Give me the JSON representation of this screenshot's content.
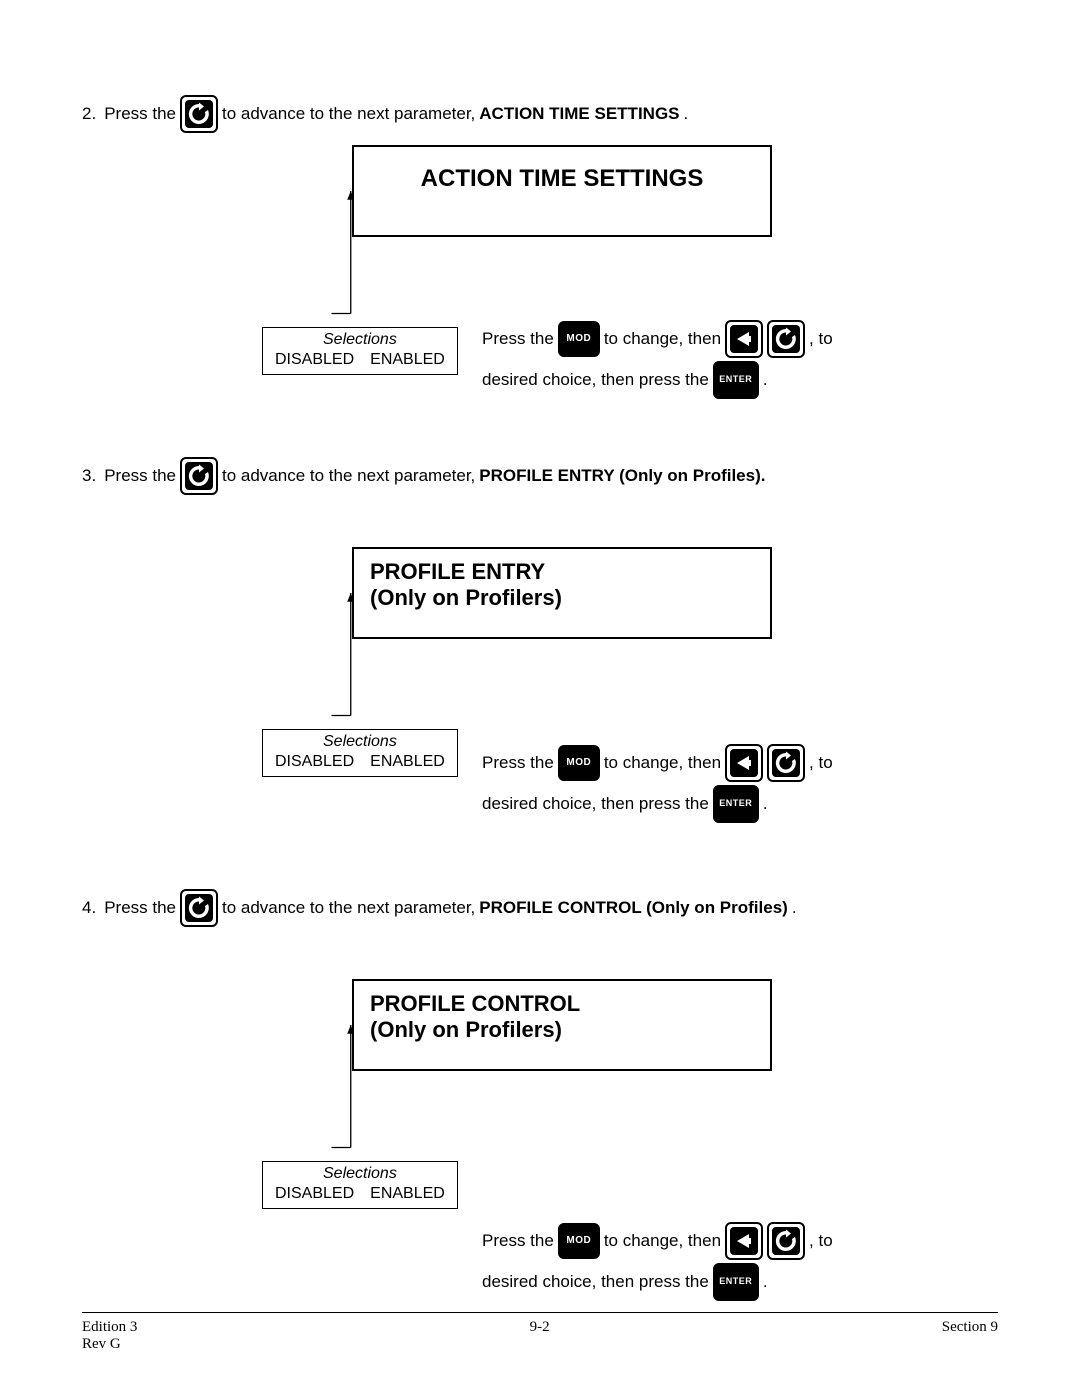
{
  "steps": {
    "s2": {
      "num": "2.",
      "prefix": "Press the",
      "mid": "to advance to the next parameter,",
      "param": "ACTION TIME SETTINGS",
      "suffix": "."
    },
    "s3": {
      "num": "3.",
      "prefix": "Press the",
      "mid": "to advance to the next parameter,",
      "param": "PROFILE ENTRY (Only on Profiles).",
      "suffix": ""
    },
    "s4": {
      "num": "4.",
      "prefix": "Press the",
      "mid": "to advance to the next parameter,",
      "param": "PROFILE CONTROL (Only on Profiles)",
      "suffix": "."
    }
  },
  "displays": {
    "d1": "ACTION  TIME  SETTINGS",
    "d2a": "PROFILE ENTRY",
    "d2b": "(Only on Profilers)",
    "d3a": "PROFILE CONTROL",
    "d3b": "(Only on Profilers)"
  },
  "selections": {
    "title": "Selections",
    "options": "DISABLED ENABLED"
  },
  "instr": {
    "p1": "Press the",
    "p2": "to change, then",
    "p3": ", to",
    "p4": "desired choice, then press the",
    "p5": "."
  },
  "keys": {
    "mod": "MOD",
    "enter": "ENTER"
  },
  "footer": {
    "left1": "Edition 3",
    "left2": "Rev G",
    "center": "9-2",
    "right": "Section 9"
  }
}
